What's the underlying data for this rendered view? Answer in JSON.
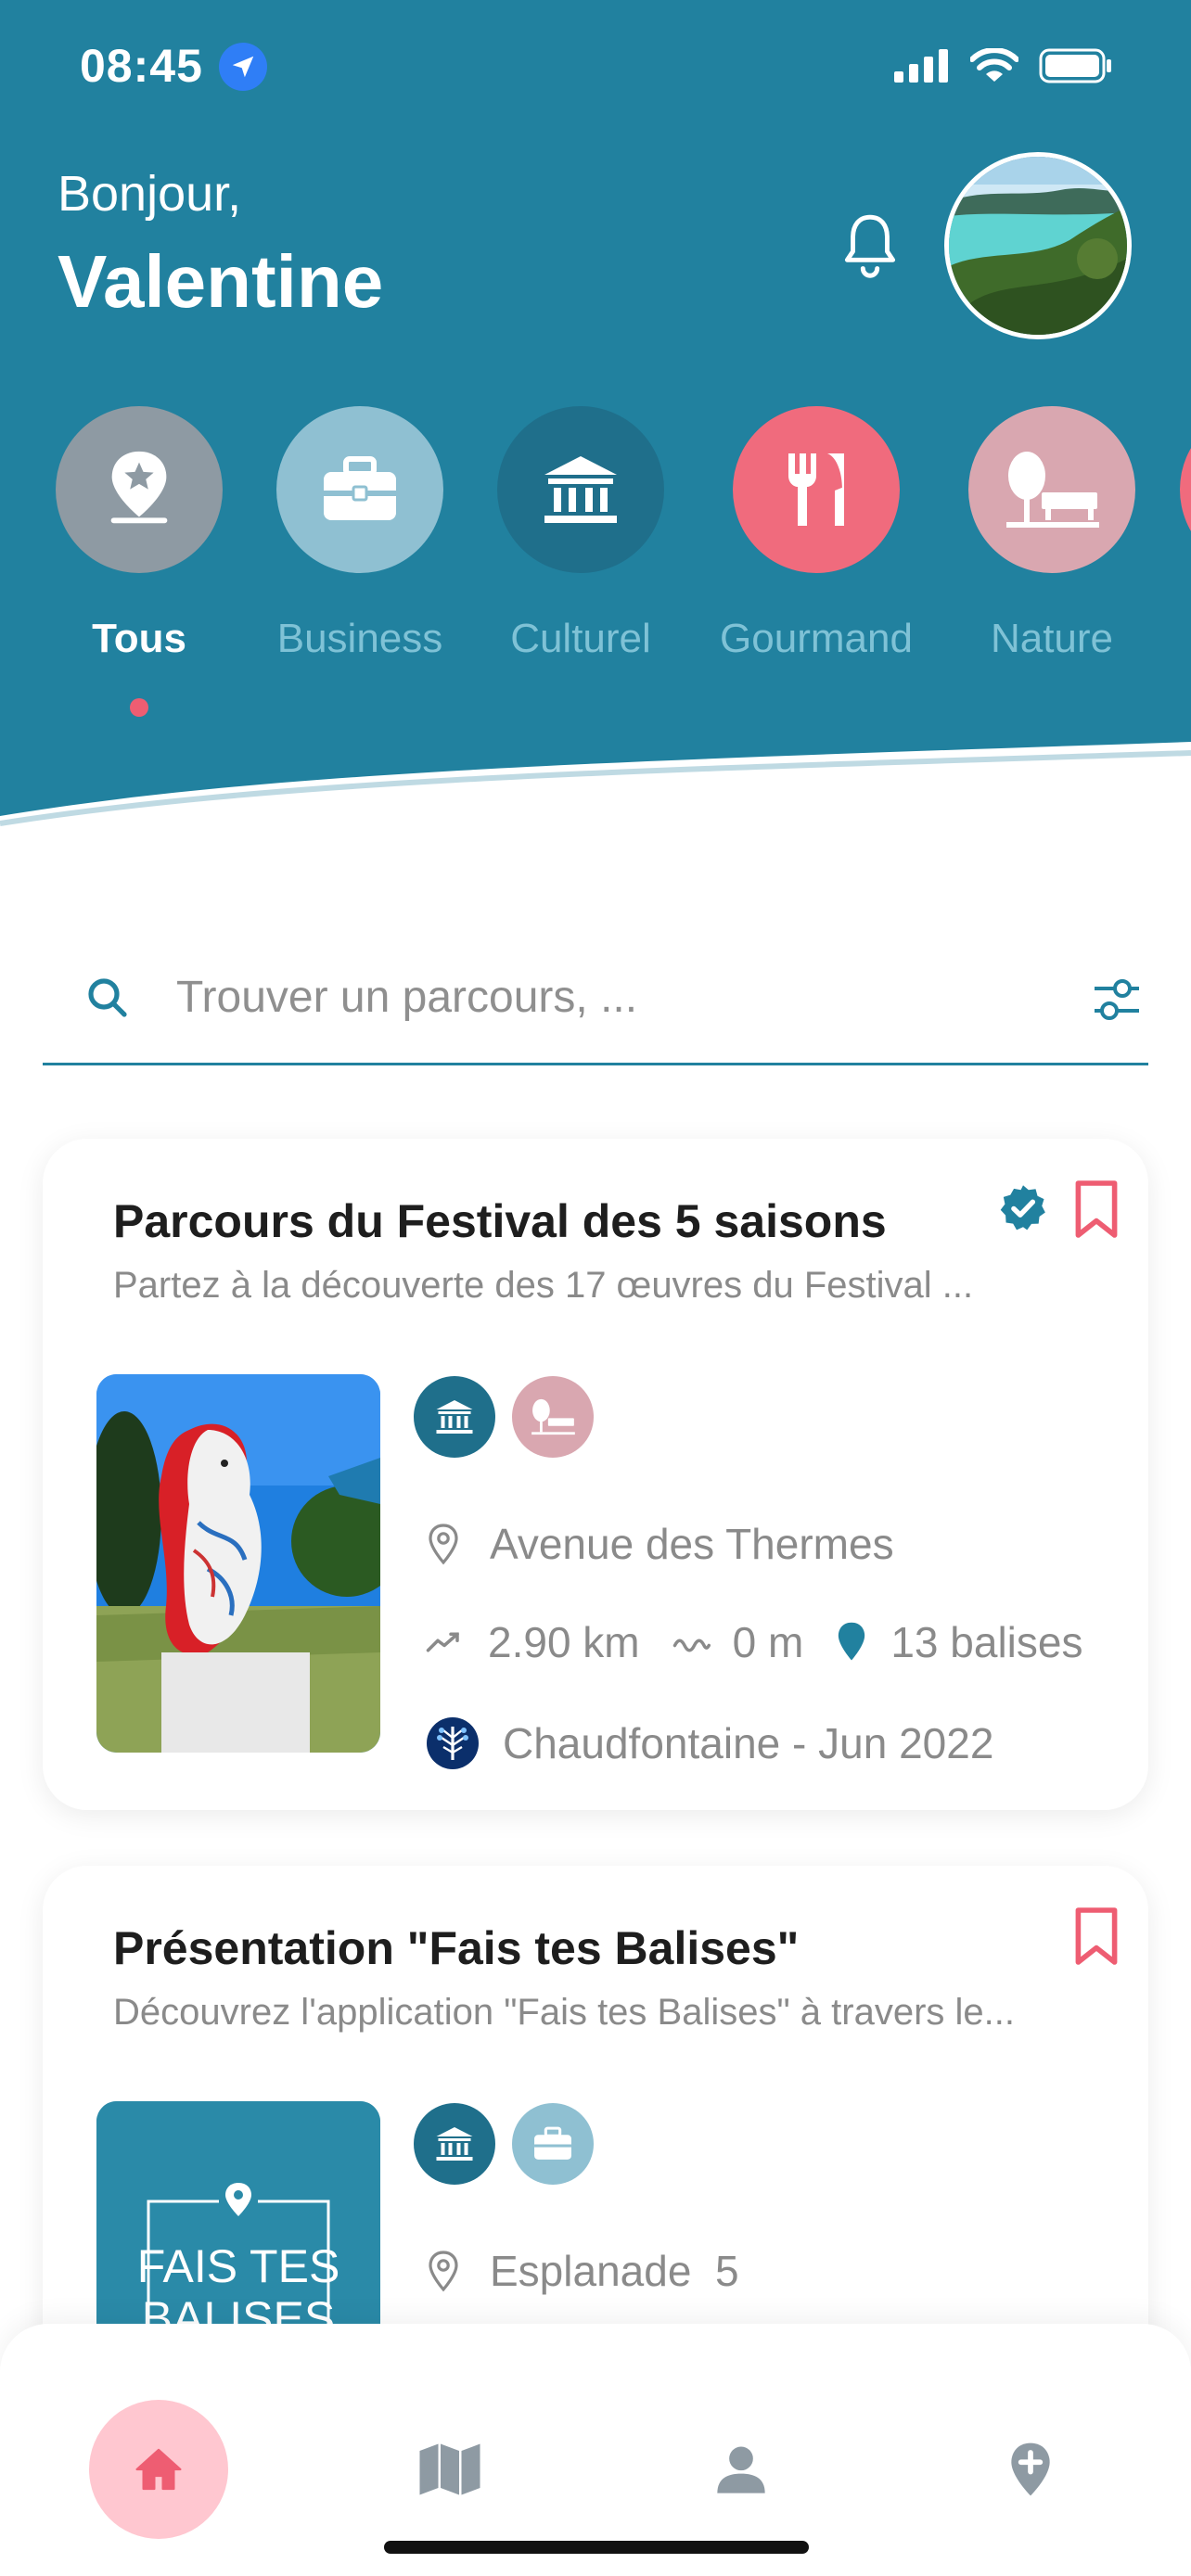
{
  "status_bar": {
    "time": "08:45"
  },
  "greeting": {
    "hello": "Bonjour,",
    "name": "Valentine"
  },
  "categories": [
    {
      "label": "Tous",
      "icon": "map-pin-star-icon",
      "color": "#8e9aa3",
      "active": true
    },
    {
      "label": "Business",
      "icon": "briefcase-icon",
      "color": "#8fc0d2",
      "active": false
    },
    {
      "label": "Culturel",
      "icon": "museum-icon",
      "color": "#1f6f8b",
      "active": false
    },
    {
      "label": "Gourmand",
      "icon": "fork-knife-icon",
      "color": "#f06b7d",
      "active": false
    },
    {
      "label": "Nature",
      "icon": "tree-bench-icon",
      "color": "#d9a7b0",
      "active": false
    }
  ],
  "search": {
    "placeholder": "Trouver un parcours, ..."
  },
  "cards": [
    {
      "title": "Parcours du Festival des 5 saisons",
      "subtitle": "Partez à la découverte des 17 œuvres du Festival ...",
      "verified": true,
      "location": "Avenue des Thermes",
      "distance": "2.90 km",
      "elevation": "0 m",
      "beacons": "13 balises",
      "author": "Chaudfontaine - Jun 2022",
      "tags": [
        "museum-icon",
        "tree-bench-icon"
      ]
    },
    {
      "title": "Présentation \"Fais tes Balises\"",
      "subtitle": "Découvrez l'application \"Fais tes Balises\" à travers le...",
      "verified": false,
      "location": "Esplanade  5",
      "thumb_text_1": "FAIS TES",
      "thumb_text_2": "BALISES",
      "tags": [
        "museum-icon",
        "briefcase-icon"
      ]
    }
  ],
  "colors": {
    "primary": "#21819f",
    "accent": "#ee5d72",
    "home_tab_bg": "#ffc7d0"
  },
  "tabbar": [
    "home-icon",
    "map-icon",
    "profile-icon",
    "add-location-icon"
  ]
}
